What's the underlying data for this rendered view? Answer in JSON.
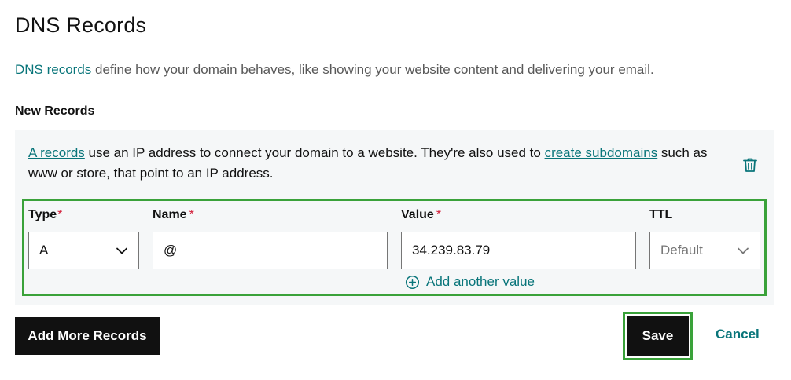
{
  "header": {
    "title": "DNS Records"
  },
  "intro": {
    "link_text": "DNS records",
    "text": " define how your domain behaves, like showing your website content and delivering your email."
  },
  "section": {
    "label": "New Records"
  },
  "record": {
    "desc_link1": "A records",
    "desc_text1": " use an IP address to connect your domain to a website. They're also used to ",
    "desc_link2": "create subdomains",
    "desc_text2": " such as www or store, that point to an IP address.",
    "delete_icon": "trash-icon",
    "fields": {
      "type_label": "Type",
      "type_required": "*",
      "type_value": "A",
      "name_label": "Name",
      "name_required": "*",
      "name_value": "@",
      "value_label": "Value",
      "value_required": "*",
      "value_value": "34.239.83.79",
      "ttl_label": "TTL",
      "ttl_value": "Default"
    },
    "add_value": {
      "icon": "plus-circle-icon",
      "label": "Add another value"
    }
  },
  "actions": {
    "add_more_label": "Add More Records",
    "save_label": "Save",
    "cancel_label": "Cancel"
  },
  "colors": {
    "link": "#09757a",
    "highlight_outline": "#3aa23a",
    "required": "#d21d38",
    "primary_button": "#111111"
  }
}
